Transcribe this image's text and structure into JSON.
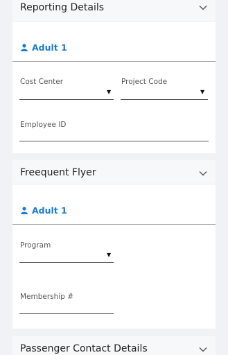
{
  "reporting": {
    "title": "Reporting Details",
    "adult_label": "Adult 1",
    "cost_center_label": "Cost Center",
    "project_code_label": "Project Code",
    "employee_id_label": "Employee ID"
  },
  "frequent_flyer": {
    "title": "Freequent Flyer",
    "adult_label": "Adult 1",
    "program_label": "Program",
    "membership_label": "Membership #"
  },
  "passenger_contact": {
    "title": "Passenger Contact Details"
  },
  "colors": {
    "accent": "#1a7ccf",
    "background": "#f0f2f5",
    "card": "#ffffff"
  },
  "icons": {
    "dropdown_caret": "▼",
    "chevron": "chevron-down-icon",
    "user": "user-icon"
  }
}
